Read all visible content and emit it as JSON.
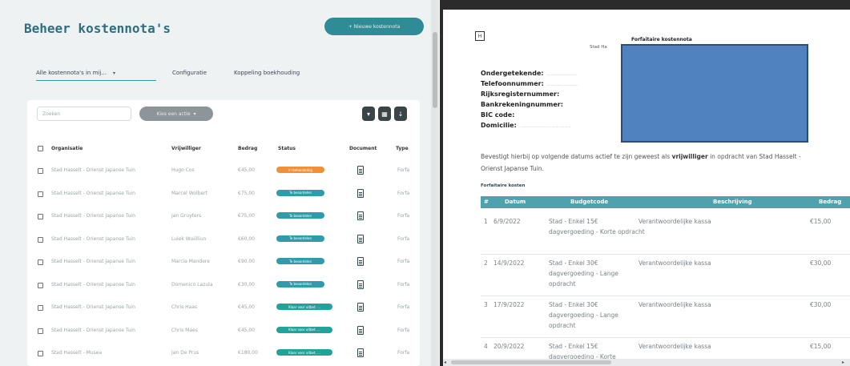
{
  "left_panel": {
    "title": "Beheer kostennota's",
    "new_button": "+ Nieuwe kostennota",
    "filter": {
      "value": "Alle kostennota's in mij...",
      "chevron": "chevron-down-icon"
    },
    "tabs": [
      "Configuratie",
      "Koppeling boekhouding"
    ],
    "search_placeholder": "Zoeken",
    "bulk_action": "Kies een actie",
    "icon_buttons": [
      "filter-icon",
      "columns-icon",
      "download-icon"
    ],
    "columns": [
      "Organisatie",
      "Vrijwilliger",
      "Bedrag",
      "Status",
      "Document",
      "Type"
    ],
    "rows": [
      {
        "org": "Stad Hasselt - Orienst Japanse Tuin",
        "volunteer": "Hugo Cos",
        "amount": "€45,00",
        "status": "In behandeling",
        "status_color": "#f0913a",
        "type": "Forfa"
      },
      {
        "org": "Stad Hasselt - Orienst Japanse Tuin",
        "volunteer": "Marcel Wolbert",
        "amount": "€75,00",
        "status": "Te beoordelen",
        "status_color": "#2f9bab",
        "type": "Forfa"
      },
      {
        "org": "Stad Hasselt - Orienst Japanse Tuin",
        "volunteer": "Jan Gruyters",
        "amount": "€75,00",
        "status": "Te beoordelen",
        "status_color": "#2f9bab",
        "type": "Forfa"
      },
      {
        "org": "Stad Hasselt - Orienst Japanse Tuin",
        "volunteer": "Luiek Wuiilliun",
        "amount": "€60,00",
        "status": "Te beoordelen",
        "status_color": "#2f9bab",
        "type": "Forfa"
      },
      {
        "org": "Stad Hasselt - Orienst Japanse Tuin",
        "volunteer": "Marcia Mandere",
        "amount": "€90,00",
        "status": "Te beoordelen",
        "status_color": "#2f9bab",
        "type": "Forfa"
      },
      {
        "org": "Stad Hasselt - Orienst Japanse Tuin",
        "volunteer": "Domenico Lazula",
        "amount": "€30,00",
        "status": "Te beoordelen",
        "status_color": "#2f9bab",
        "type": "Forfa"
      },
      {
        "org": "Stad Hasselt - Orienst Japanse Tuin",
        "volunteer": "Chris Haas",
        "amount": "€45,00",
        "status": "Klaar voor uitbet. ...",
        "status_color": "#22a39a",
        "type": "Forfa"
      },
      {
        "org": "Stad Hasselt - Orienst Japanse Tuin",
        "volunteer": "Chris Maes",
        "amount": "€45,00",
        "status": "Klaar voor uitbet. ...",
        "status_color": "#22a39a",
        "type": "Forfa"
      },
      {
        "org": "Stad Hasselt - Musea",
        "volunteer": "Jan De Prus",
        "amount": "€180,00",
        "status": "Klaar voor uitbet. ...",
        "status_color": "#22a39a",
        "type": "Forfa"
      }
    ]
  },
  "document": {
    "logo": "H",
    "title": "Forfaitaire kostennota",
    "subtitle": "Stad Ha",
    "fields": [
      {
        "label": "Ondergetekende:",
        "value": "........................"
      },
      {
        "label": "Telefoonnummer:",
        "value": "........................"
      },
      {
        "label": "Rijksregisternummer:",
        "value": ""
      },
      {
        "label": "Bankrekeningnummer:",
        "value": ""
      },
      {
        "label": "BIC code:",
        "value": ""
      },
      {
        "label": "Domicilie:",
        "value": "........................................"
      }
    ],
    "statement_pre": "Bevestigt hierbij op volgende datums actief te zijn geweest als",
    "statement_bold": "vrijwilliger",
    "statement_post": "in opdracht van Stad Hasselt - Orienst Japanse Tuin.",
    "table_caption": "Forfaitaire kosten",
    "table_headers": [
      "#",
      "Datum",
      "Budgetcode",
      "Beschrijving",
      "Bedrag"
    ],
    "table_rows": [
      {
        "nr": "1",
        "date": "6/9/2022",
        "code": "Stad - Enkel 15€ dagvergoeding - Korte opdracht",
        "desc": "Verantwoordelijke kassa",
        "amount": "€15,00"
      },
      {
        "nr": "2",
        "date": "14/9/2022",
        "code": "Stad - Enkel 30€ dagvergoeding - Lange opdracht",
        "desc": "Verantwoordelijke kassa",
        "amount": "€30,00"
      },
      {
        "nr": "3",
        "date": "17/9/2022",
        "code": "Stad - Enkel 30€ dagvergoeding - Lange opdracht",
        "desc": "Verantwoordelijke kassa",
        "amount": "€30,00"
      },
      {
        "nr": "4",
        "date": "20/9/2022",
        "code": "Stad - Enkel 15€ dagvergoeding - Korte",
        "desc": "Verantwoordelijke kassa",
        "amount": "€15,00"
      }
    ]
  }
}
